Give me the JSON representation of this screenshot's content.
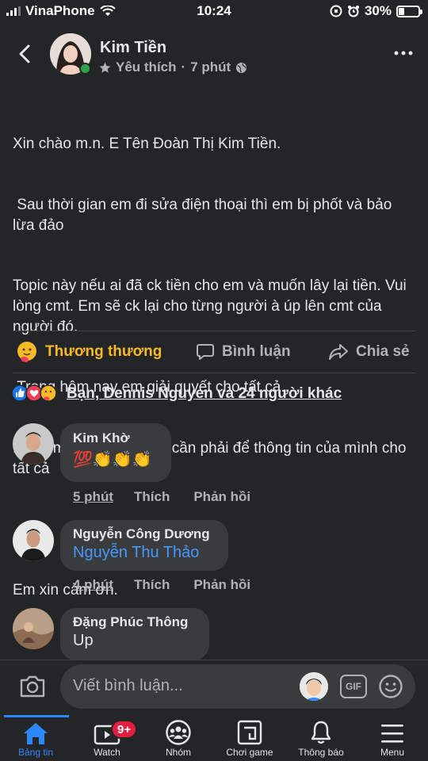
{
  "status_bar": {
    "carrier": "VinaPhone",
    "time": "10:24",
    "battery": "30%",
    "battery_level": 0.3
  },
  "header": {
    "author": "Kim Tiền",
    "audience": "Yêu thích",
    "separator": "·",
    "time": "7 phút"
  },
  "post": {
    "lines": [
      "Xin chào m.n. E Tên Đoàn Thị Kim Tiền.",
      " Sau thời gian em đi sửa điện thoại thì em bị phốt và bảo lừa đảo",
      "Topic này nếu ai đã ck tiền cho em và muốn lây lại tiền. Vui lòng cmt. Em sẽ ck lại cho từng người à úp lên cmt của người đó.",
      " Trong hôm nay em giải quyết cho tất cả.",
      "Nếu em lừa đảo.  Em k cần phải để thông tin của mình cho tất cả",
      "",
      "Em xin cảm ơn."
    ]
  },
  "actions": {
    "react": "Thương thương",
    "comment": "Bình luận",
    "share": "Chia sẻ"
  },
  "reactions_summary": "Bạn, Dennis Nguyen và 24 người khác",
  "comments": [
    {
      "name": "Kim Khờ",
      "text": "💯👏👏👏",
      "time": "5 phút",
      "like": "Thích",
      "reply": "Phản hồi"
    },
    {
      "name": "Nguyễn Công Dương",
      "text": "Nguyễn Thu Thảo",
      "time": "4 phút",
      "like": "Thích",
      "reply": "Phản hồi"
    },
    {
      "name": "Đặng Phúc Thông",
      "text": "Up"
    }
  ],
  "composer": {
    "placeholder": "Viết bình luận...",
    "gif": "GIF"
  },
  "tabbar": {
    "items": [
      {
        "label": "Bảng tin"
      },
      {
        "label": "Watch",
        "badge": "9+"
      },
      {
        "label": "Nhóm"
      },
      {
        "label": "Chơi game"
      },
      {
        "label": "Thông báo"
      },
      {
        "label": "Menu"
      }
    ]
  },
  "colors": {
    "accent": "#2d88ff",
    "care": "#f7b928",
    "link": "#4599ff"
  }
}
